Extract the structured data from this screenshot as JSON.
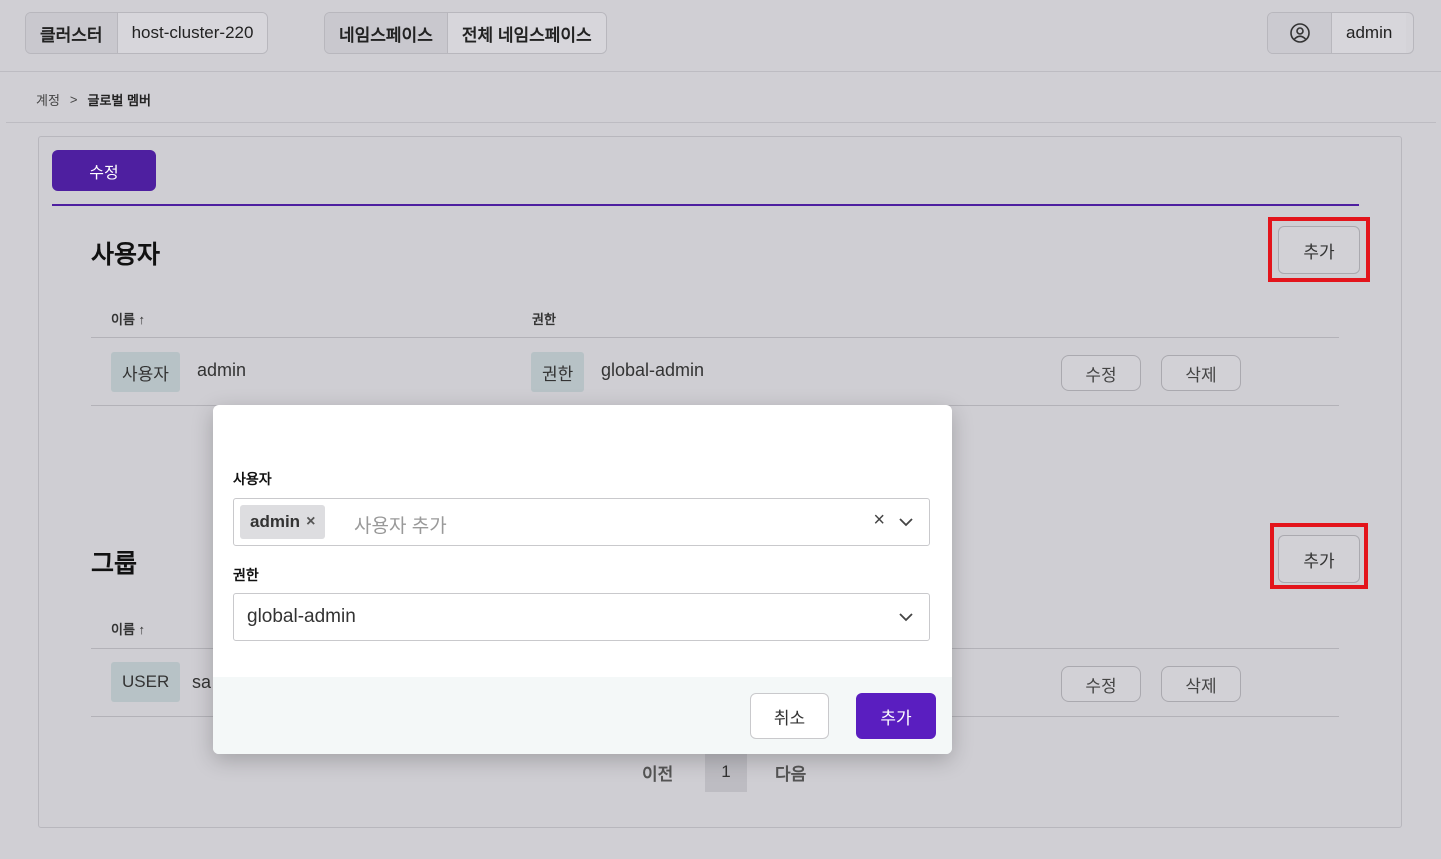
{
  "header": {
    "cluster_label": "클러스터",
    "cluster_value": "host-cluster-220",
    "namespace_label": "네임스페이스",
    "namespace_value": "전체 네임스페이스",
    "user_name": "admin"
  },
  "breadcrumb": {
    "parent": "계정",
    "separator": ">",
    "current": "글로벌 멤버"
  },
  "tabs": {
    "edit": "수정"
  },
  "users_section": {
    "title": "사용자",
    "add_label": "추가",
    "columns": {
      "name": "이름",
      "sort_indicator": "↑",
      "role": "권한"
    },
    "rows": [
      {
        "type_tag": "사용자",
        "name": "admin",
        "role_tag": "권한",
        "role": "global-admin",
        "edit_label": "수정",
        "delete_label": "삭제"
      }
    ]
  },
  "groups_section": {
    "title": "그룹",
    "add_label": "추가",
    "columns": {
      "name": "이름",
      "sort_indicator": "↑"
    },
    "rows": [
      {
        "type_tag": "USER",
        "name": "sa",
        "edit_label": "수정",
        "delete_label": "삭제"
      }
    ]
  },
  "pagination": {
    "prev": "이전",
    "current_page": "1",
    "next": "다음"
  },
  "modal": {
    "user_label": "사용자",
    "selected_chip": "admin",
    "chip_remove": "×",
    "user_placeholder": "사용자 추가",
    "clear_symbol": "×",
    "role_label": "권한",
    "role_value": "global-admin",
    "cancel_label": "취소",
    "confirm_label": "추가"
  },
  "colors": {
    "accent": "#4e1fa0",
    "highlight": "#e3141b"
  },
  "icons": [
    "user-circle-icon",
    "chevron-right-icon",
    "sort-up-icon",
    "chevron-down-icon",
    "close-icon"
  ]
}
